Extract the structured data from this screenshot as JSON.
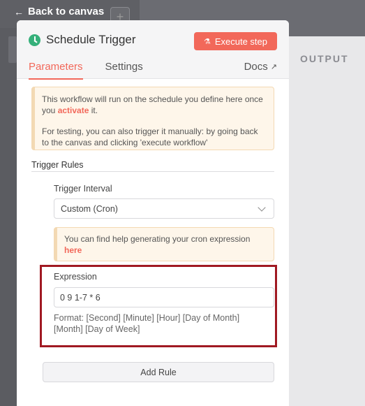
{
  "nav": {
    "back_label": "Back to canvas"
  },
  "background": {
    "plus_label": "+",
    "output_label": "OUTPUT"
  },
  "panel": {
    "title": "Schedule Trigger",
    "execute_label": "Execute step",
    "tabs": [
      {
        "label": "Parameters",
        "active": true
      },
      {
        "label": "Settings",
        "active": false
      }
    ],
    "docs_label": "Docs"
  },
  "notice": {
    "line1_pre": "This workflow will run on the schedule you define here once you ",
    "line1_link": "activate",
    "line1_post": " it.",
    "line2": "For testing, you can also trigger it manually: by going back to the canvas and clicking 'execute workflow'"
  },
  "trigger_rules": {
    "section_title": "Trigger Rules",
    "interval_label": "Trigger Interval",
    "interval_value": "Custom (Cron)",
    "hint_pre": "You can find help generating your cron expression ",
    "hint_link": "here",
    "expression_label": "Expression",
    "expression_value": "0 9 1-7 * 6",
    "format_text": "Format: [Second] [Minute] [Hour] [Day of Month] [Month] [Day of Week]",
    "add_rule_label": "Add Rule"
  },
  "colors": {
    "accent": "#f2685a",
    "trigger_icon": "#35b07a",
    "highlight_box": "#a01922",
    "notice_bg": "#fef6ea"
  },
  "icons": {
    "back": "arrow-left-icon",
    "trigger": "clock-icon",
    "execute": "flask-icon",
    "docs": "external-link-icon",
    "select": "chevron-down-icon"
  }
}
